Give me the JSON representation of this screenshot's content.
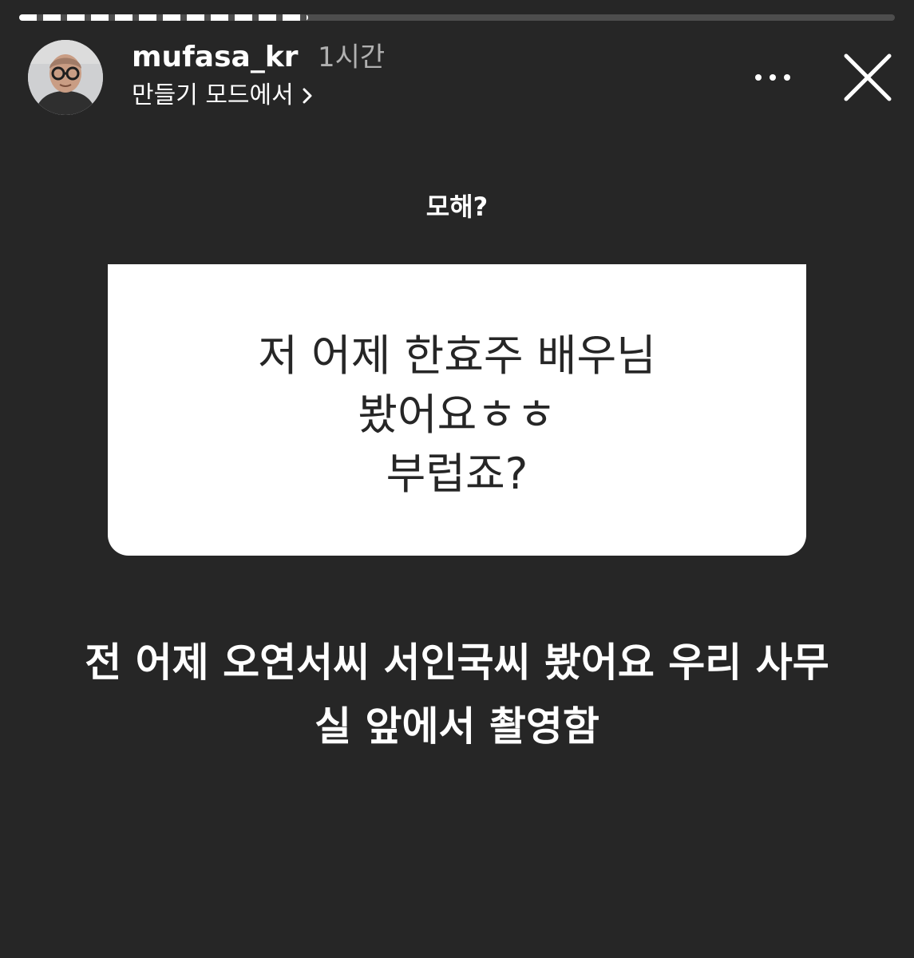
{
  "story": {
    "progress_fraction": 0.33
  },
  "header": {
    "username": "mufasa_kr",
    "time": "1시간",
    "subtitle": "만들기 모드에서",
    "more_icon": "more-dots-icon",
    "close_icon": "close-icon"
  },
  "question_sticker": {
    "label": "모해?",
    "lines": [
      "저 어제 한효주 배우님",
      "봤어요ㅎㅎ",
      "부럽죠?"
    ]
  },
  "answer": {
    "lines": [
      "전 어제 오연서씨 서인국씨 봤어요 우리 사무",
      "실 앞에서 촬영함"
    ]
  },
  "colors": {
    "background": "#262626",
    "card": "#ffffff",
    "card_text": "#262626",
    "muted_text": "#b0b0b0"
  }
}
